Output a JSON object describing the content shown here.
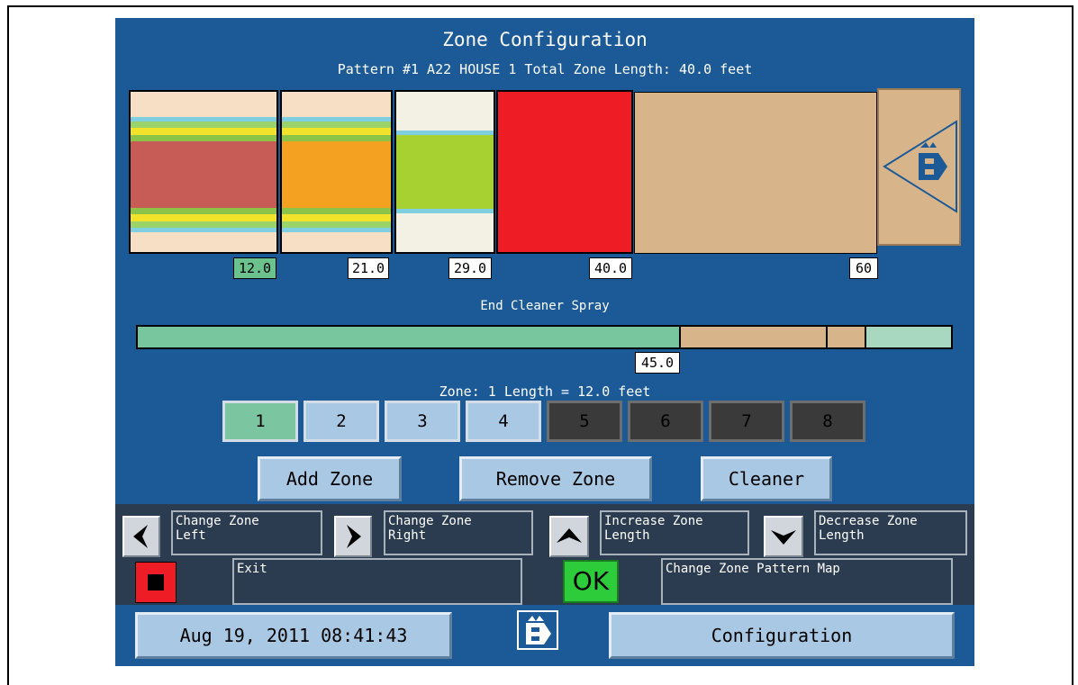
{
  "header": {
    "title": "Zone Configuration",
    "subtitle": "Pattern #1 A22 HOUSE 1  Total Zone Length: 40.0 feet"
  },
  "zone_markers": [
    {
      "label": "12.0",
      "highlight": true
    },
    {
      "label": "21.0",
      "highlight": false
    },
    {
      "label": "29.0",
      "highlight": false
    },
    {
      "label": "40.0",
      "highlight": false
    },
    {
      "label": "60",
      "highlight": false
    }
  ],
  "spray": {
    "label": "End Cleaner Spray",
    "marker": "45.0",
    "colors": {
      "spray": "#78c69e",
      "lane": "#d8b48a",
      "end": "#a8d8c0"
    }
  },
  "zone_info": "Zone: 1   Length = 12.0 feet",
  "zone_buttons": [
    {
      "label": "1",
      "state": "active"
    },
    {
      "label": "2",
      "state": "normal"
    },
    {
      "label": "3",
      "state": "normal"
    },
    {
      "label": "4",
      "state": "normal"
    },
    {
      "label": "5",
      "state": "disabled"
    },
    {
      "label": "6",
      "state": "disabled"
    },
    {
      "label": "7",
      "state": "disabled"
    },
    {
      "label": "8",
      "state": "disabled"
    }
  ],
  "actions": {
    "add": "Add Zone",
    "remove": "Remove Zone",
    "cleaner": "Cleaner"
  },
  "controls": {
    "left": "Change Zone\nLeft",
    "right": "Change Zone\nRight",
    "increase": "Increase Zone\nLength",
    "decrease": "Decrease Zone\nLength",
    "exit": "Exit",
    "ok_label": "OK",
    "pattern_map": "Change Zone Pattern Map"
  },
  "footer": {
    "datetime": "Aug 19, 2011 08:41:43",
    "screen": "Configuration"
  },
  "colors": {
    "background": "#1b5a96",
    "zone1": "#c75b55",
    "zone2": "#f4a020",
    "zone3": "#a7d131",
    "zone4": "#ee1c24",
    "lane": "#d8b48a",
    "ok_green": "#2dcc3a",
    "stop_red": "#ee1c24"
  }
}
